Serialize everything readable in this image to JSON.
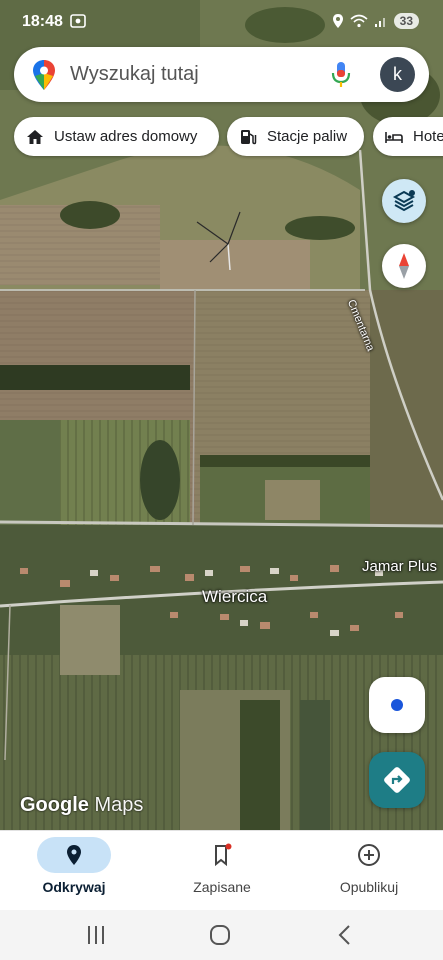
{
  "status_bar": {
    "time": "18:48",
    "battery": "33"
  },
  "search": {
    "placeholder": "Wyszukaj tutaj",
    "avatar_letter": "k"
  },
  "chips": [
    {
      "label": "Ustaw adres domowy",
      "icon": "home-icon"
    },
    {
      "label": "Stacje paliw",
      "icon": "gas-station-icon"
    },
    {
      "label": "Hote",
      "icon": "hotel-icon"
    }
  ],
  "map": {
    "labels": {
      "town": "Wiercica",
      "business": "Jamar Plus",
      "street": "Cmentarna"
    },
    "logo": {
      "google": "Google",
      "maps": "Maps"
    }
  },
  "bottom_nav": {
    "items": [
      {
        "label": "Odkrywaj",
        "icon": "explore-pin-icon",
        "active": true
      },
      {
        "label": "Zapisane",
        "icon": "bookmark-icon",
        "active": false
      },
      {
        "label": "Opublikuj",
        "icon": "add-circle-icon",
        "active": false
      }
    ]
  },
  "colors": {
    "active_pill": "#c8e2f7",
    "directions": "#1e7d86",
    "location_dot": "#1a56db"
  }
}
